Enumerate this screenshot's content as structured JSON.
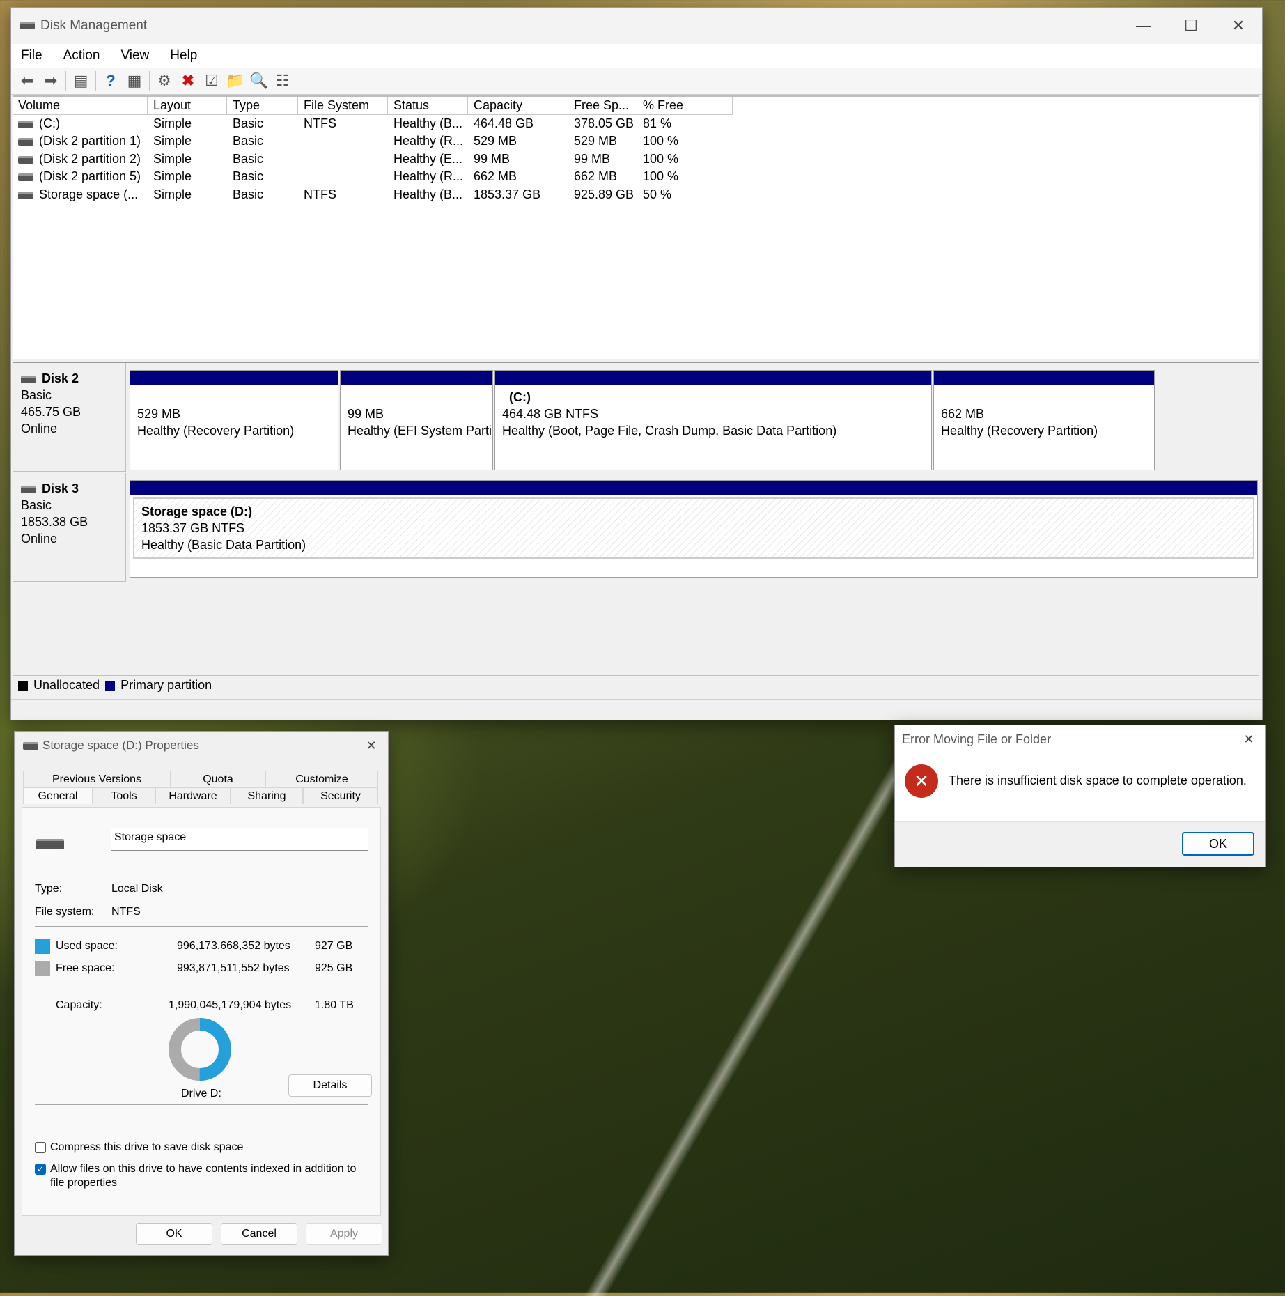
{
  "dm": {
    "title": "Disk Management",
    "menu": [
      "File",
      "Action",
      "View",
      "Help"
    ],
    "columns": [
      "Volume",
      "Layout",
      "Type",
      "File System",
      "Status",
      "Capacity",
      "Free Sp...",
      "% Free"
    ],
    "rows": [
      [
        "(C:)",
        "Simple",
        "Basic",
        "NTFS",
        "Healthy (B...",
        "464.48 GB",
        "378.05 GB",
        "81 %"
      ],
      [
        "(Disk 2 partition 1)",
        "Simple",
        "Basic",
        "",
        "Healthy (R...",
        "529 MB",
        "529 MB",
        "100 %"
      ],
      [
        "(Disk 2 partition 2)",
        "Simple",
        "Basic",
        "",
        "Healthy (E...",
        "99 MB",
        "99 MB",
        "100 %"
      ],
      [
        "(Disk 2 partition 5)",
        "Simple",
        "Basic",
        "",
        "Healthy (R...",
        "662 MB",
        "662 MB",
        "100 %"
      ],
      [
        "Storage space (...",
        "Simple",
        "Basic",
        "NTFS",
        "Healthy (B...",
        "1853.37 GB",
        "925.89 GB",
        "50 %"
      ]
    ],
    "disk2": {
      "name": "Disk 2",
      "type": "Basic",
      "size": "465.75 GB",
      "state": "Online",
      "partitions": [
        {
          "title": "",
          "line1": "529 MB",
          "line2": "Healthy (Recovery Partition)"
        },
        {
          "title": "",
          "line1": "99 MB",
          "line2": "Healthy (EFI System Parti"
        },
        {
          "title": "(C:)",
          "line1": "464.48 GB NTFS",
          "line2": "Healthy (Boot, Page File, Crash Dump, Basic Data Partition)"
        },
        {
          "title": "",
          "line1": "662 MB",
          "line2": "Healthy (Recovery Partition)"
        }
      ]
    },
    "disk3": {
      "name": "Disk 3",
      "type": "Basic",
      "size": "1853.38 GB",
      "state": "Online",
      "partition": {
        "title": "Storage space  (D:)",
        "line1": "1853.37 GB NTFS",
        "line2": "Healthy (Basic Data Partition)"
      }
    },
    "legend": {
      "unallocated": "Unallocated",
      "primary": "Primary partition",
      "unallocated_color": "#000000",
      "primary_color": "#00007f"
    }
  },
  "props": {
    "title": "Storage space (D:) Properties",
    "tabs_top": [
      "Previous Versions",
      "Quota",
      "Customize"
    ],
    "tabs_bottom": [
      "General",
      "Tools",
      "Hardware",
      "Sharing",
      "Security"
    ],
    "name_value": "Storage space",
    "type_label": "Type:",
    "type_value": "Local Disk",
    "fs_label": "File system:",
    "fs_value": "NTFS",
    "used_label": "Used space:",
    "used_bytes": "996,173,668,352 bytes",
    "used_size": "927 GB",
    "free_label": "Free space:",
    "free_bytes": "993,871,511,552 bytes",
    "free_size": "925 GB",
    "cap_label": "Capacity:",
    "cap_bytes": "1,990,045,179,904 bytes",
    "cap_size": "1.80 TB",
    "used_fraction": 0.5006,
    "used_color": "#26a0da",
    "free_color": "#ababab",
    "drive_label": "Drive D:",
    "details": "Details",
    "compress": "Compress this drive to save disk space",
    "index_line1": "Allow files on this drive to have contents indexed in addition to",
    "index_line2": "file properties",
    "ok": "OK",
    "cancel": "Cancel",
    "apply": "Apply"
  },
  "err": {
    "title": "Error Moving File or Folder",
    "message": "There is insufficient disk space to complete operation.",
    "ok": "OK",
    "icon_color": "#c42b1c"
  }
}
